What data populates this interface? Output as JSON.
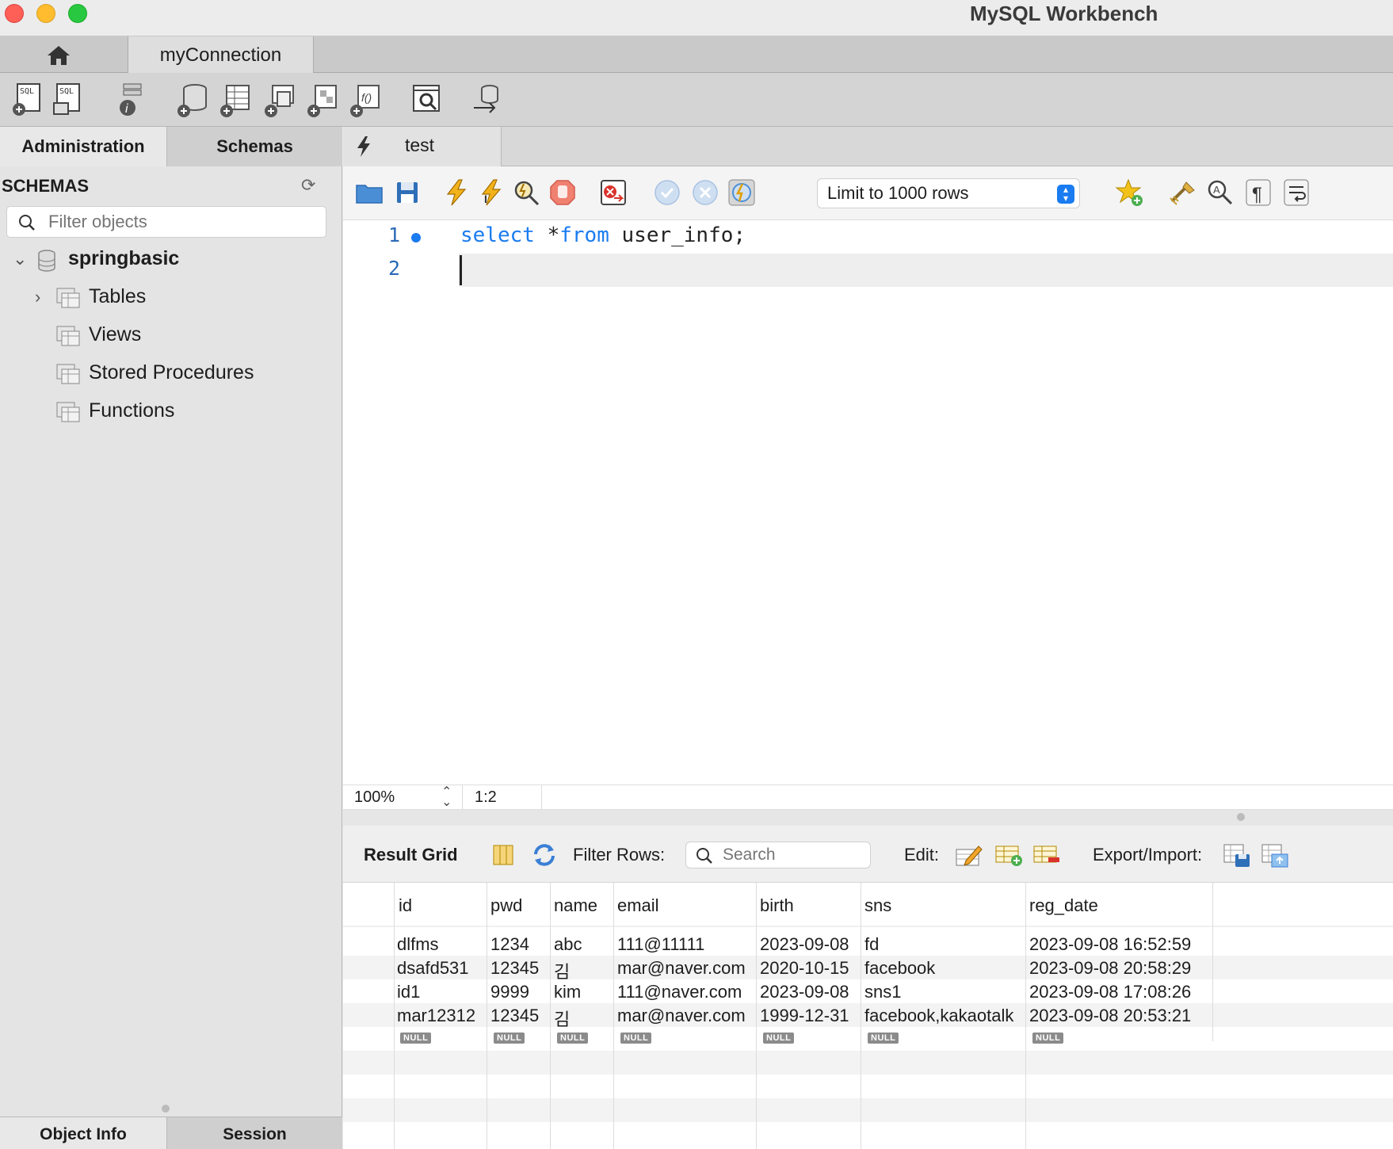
{
  "window": {
    "app_title": "MySQL Workbench"
  },
  "connection_tabs": {
    "home_icon": "home-icon",
    "active": "myConnection"
  },
  "main_toolbar": {
    "icons": [
      "new-sql-tab-icon",
      "open-sql-script-icon",
      "inspector-icon",
      "create-schema-icon",
      "create-table-icon",
      "create-view-icon",
      "create-procedure-icon",
      "create-function-icon",
      "search-table-data-icon",
      "reconnect-icon"
    ]
  },
  "sidebar": {
    "tabs": {
      "administration": "Administration",
      "schemas": "Schemas"
    },
    "section_title": "SCHEMAS",
    "filter_placeholder": "Filter objects",
    "tree": {
      "schema": "springbasic",
      "children": [
        "Tables",
        "Views",
        "Stored Procedures",
        "Functions"
      ]
    },
    "bottom_tabs": {
      "object_info": "Object Info",
      "session": "Session"
    }
  },
  "query_tab": {
    "label": "test"
  },
  "editor_toolbar": {
    "limit_label": "Limit to 1000 rows"
  },
  "editor": {
    "lines": [
      {
        "no": "1",
        "keyword1": "select",
        "mid": " *",
        "keyword2": "from",
        "rest": " user_info;"
      },
      {
        "no": "2"
      }
    ]
  },
  "status": {
    "zoom": "100%",
    "cursor": "1:2"
  },
  "result": {
    "title": "Result Grid",
    "filter_label": "Filter Rows:",
    "search_placeholder": "Search",
    "edit_label": "Edit:",
    "export_label": "Export/Import:",
    "columns": [
      "id",
      "pwd",
      "name",
      "email",
      "birth",
      "sns",
      "reg_date"
    ],
    "rows": [
      [
        "dlfms",
        "1234",
        "abc",
        "111@11111",
        "2023-09-08",
        "fd",
        "2023-09-08 16:52:59"
      ],
      [
        "dsafd531",
        "12345",
        "김",
        "mar@naver.com",
        "2020-10-15",
        "facebook",
        "2023-09-08 20:58:29"
      ],
      [
        "id1",
        "9999",
        "kim",
        "111@naver.com",
        "2023-09-08",
        "sns1",
        "2023-09-08 17:08:26"
      ],
      [
        "mar12312",
        "12345",
        "김",
        "mar@naver.com",
        "1999-12-31",
        "facebook,kakaotalk",
        "2023-09-08 20:53:21"
      ]
    ],
    "null_label": "NULL"
  },
  "colors": {
    "accent": "#1a7cf0",
    "keyword": "#1a7cf0"
  }
}
